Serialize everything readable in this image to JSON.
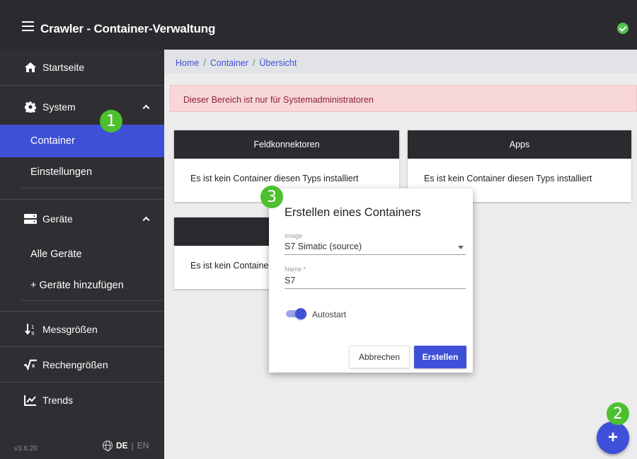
{
  "app": {
    "title": "Crawler - Container-Verwaltung",
    "status_icon": "check-circle-icon",
    "status_color": "#52c04e"
  },
  "sidebar": {
    "home": {
      "label": "Startseite",
      "icon": "home-icon"
    },
    "system": {
      "label": "System",
      "icon": "gear-icon",
      "expanded": true,
      "items": [
        {
          "label": "Container",
          "active": true
        },
        {
          "label": "Einstellungen"
        }
      ]
    },
    "devices": {
      "label": "Geräte",
      "icon": "server-icon",
      "expanded": true,
      "items": [
        {
          "label": "Alle Geräte"
        },
        {
          "label": "+ Geräte hinzufügen"
        }
      ]
    },
    "measures": {
      "label": "Messgrößen",
      "icon": "sort-numeric-icon"
    },
    "computed": {
      "label": "Rechengrößen",
      "icon": "square-root-icon"
    },
    "trends": {
      "label": "Trends",
      "icon": "chart-line-icon"
    },
    "version": "v3.6.20",
    "lang": {
      "de": "DE",
      "sep": "|",
      "en": "EN"
    }
  },
  "breadcrumb": {
    "home": "Home",
    "sep": "/",
    "container": "Container",
    "current": "Übersicht"
  },
  "alert": "Dieser Bereich ist nur für Systemadministratoren",
  "cards": [
    {
      "title": "Feldkonnektoren",
      "body": "Es ist kein Container diesen Typs installiert"
    },
    {
      "title": "Apps",
      "body": "Es ist kein Container diesen Typs installiert"
    },
    {
      "title": "",
      "body": "Es ist kein Container"
    }
  ],
  "dialog": {
    "title": "Erstellen eines Containers",
    "image_label": "Image",
    "image_value": "S7 Simatic (source)",
    "name_label": "Name *",
    "name_value": "S7",
    "autostart_label": "Autostart",
    "autostart_on": true,
    "cancel_label": "Abbrechen",
    "create_label": "Erstellen"
  },
  "fab": {
    "label": "+"
  },
  "markers": [
    "1",
    "2",
    "3"
  ],
  "colors": {
    "accent": "#3f50d8",
    "sidebar": "#2f2e32",
    "marker": "#4cc02f",
    "alert_bg": "#f7d7da"
  }
}
